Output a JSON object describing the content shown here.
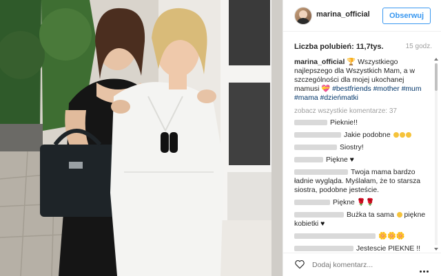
{
  "header": {
    "username": "marina_official",
    "follow_label": "Obserwuj"
  },
  "stats": {
    "likes_label": "Liczba polubień: 11,7tys.",
    "time": "15 godz."
  },
  "caption": {
    "author": "marina_official",
    "text": "Wszystkiego najlepszego dla Wszystkich Mam, a w szczególności dla mojej ukochanej mamusi",
    "tags": [
      "#bestfriends",
      "#mother",
      "#mum",
      "#mama",
      "#dzieńmatki"
    ]
  },
  "view_all_label": "zobacz wszystkie komentarze: 37",
  "comments": [
    {
      "text": "Pieknie!!"
    },
    {
      "text": "Jakie podobne"
    },
    {
      "text": "Siostry!"
    },
    {
      "text": "Piękne"
    },
    {
      "text": "Twoja mama bardzo ładnie wygląda. Myślałam, że to starsza siostra, podobne jesteście."
    },
    {
      "text": "Piękne"
    },
    {
      "text": "Bużka ta sama"
    },
    {
      "text": "piękne kobietki"
    },
    {
      "text": "Jestescie PIEKNE !!"
    }
  ],
  "footer": {
    "add_comment_placeholder": "Dodaj komentarz..."
  },
  "icons": {
    "like": "heart-outline-icon",
    "more": "more-options-icon"
  },
  "colors": {
    "accent": "#3897f0",
    "hashtag": "#003569",
    "muted": "#a0a0a0"
  }
}
